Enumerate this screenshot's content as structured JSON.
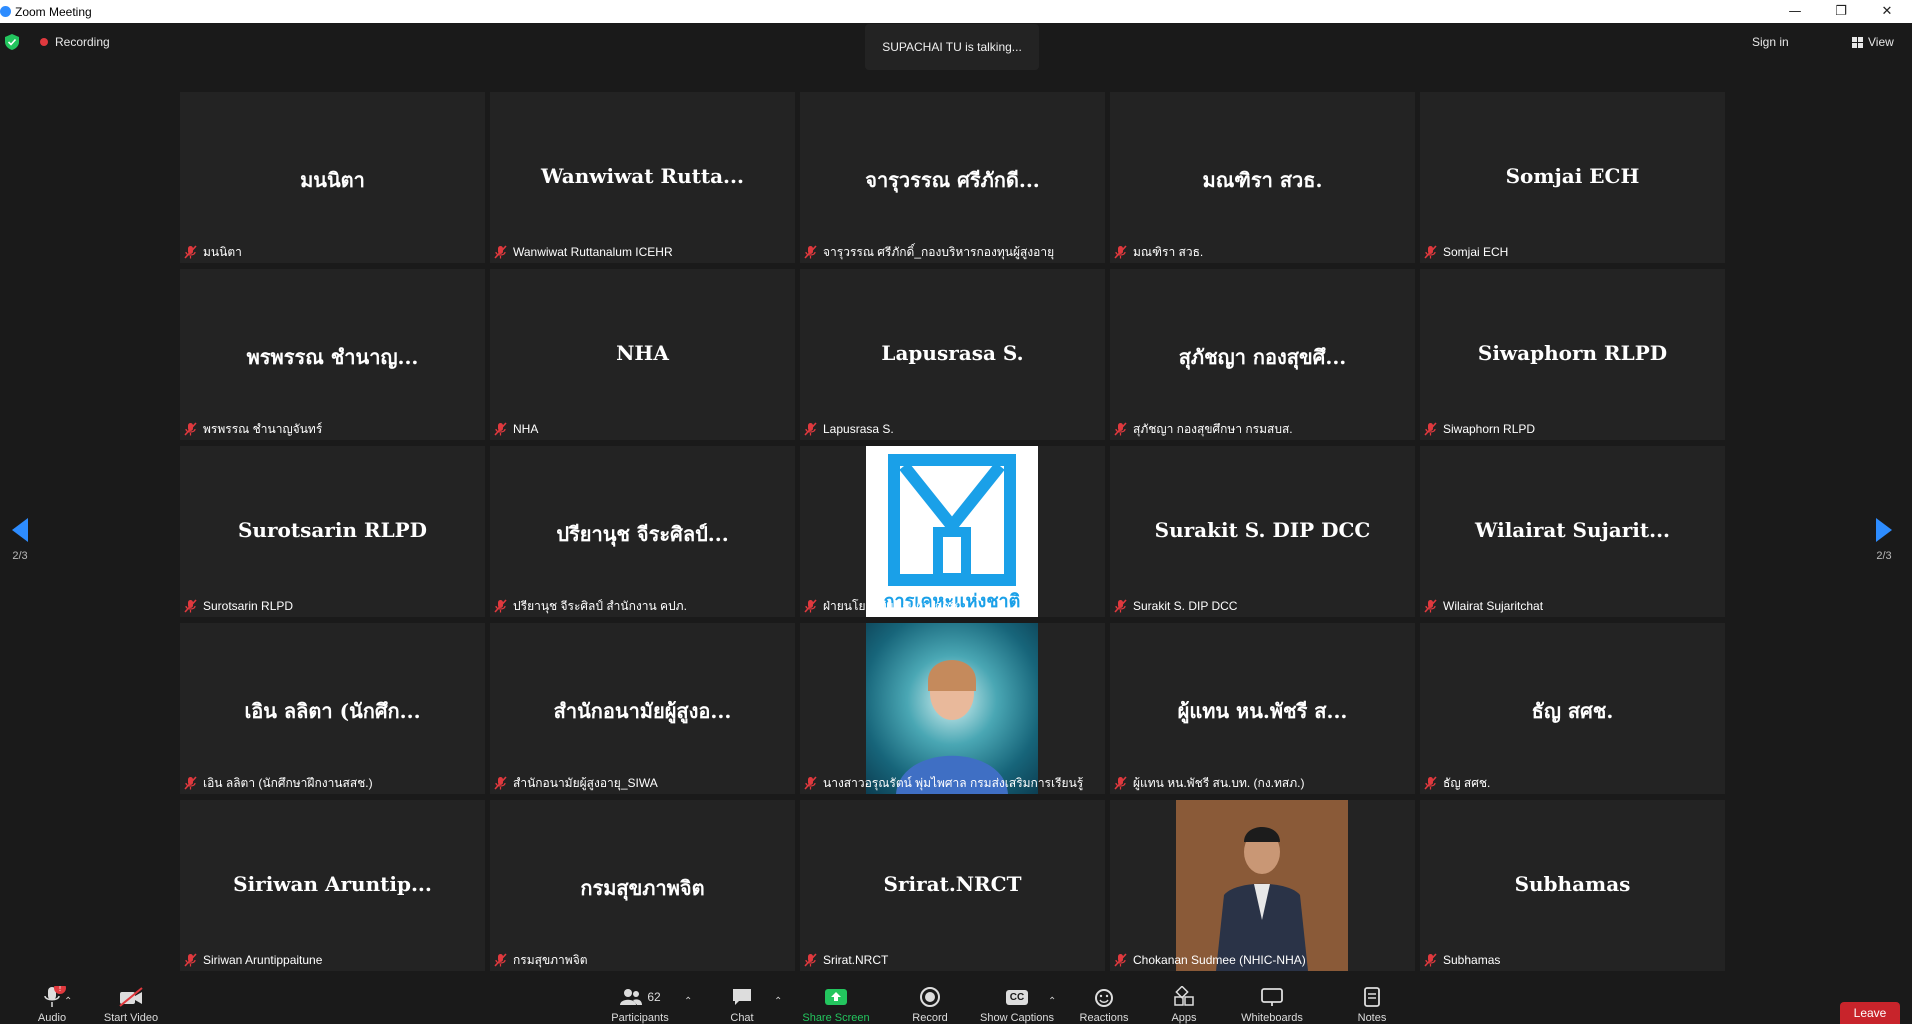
{
  "window": {
    "title": "Zoom Meeting",
    "min": "—",
    "max": "❐",
    "close": "✕"
  },
  "topbar": {
    "recording": "Recording",
    "talking": "SUPACHAI TU is talking...",
    "signin": "Sign in",
    "view": "View"
  },
  "pager": {
    "left": "2/3",
    "right": "2/3"
  },
  "tiles": [
    {
      "big": "มนนิตา",
      "label": "มนนิตา"
    },
    {
      "big": "Wanwiwat  Rutta...",
      "label": "Wanwiwat Ruttanalum ICEHR"
    },
    {
      "big": "จารุวรรณ ศรีภักดี...",
      "label": "จารุวรรณ ศรีภักดิ์_กองบริหารกองทุนผู้สูงอายุ"
    },
    {
      "big": "มณฑิรา สวธ.",
      "label": "มณฑิรา สวธ."
    },
    {
      "big": "Somjai ECH",
      "label": "Somjai ECH"
    },
    {
      "big": "พรพรรณ ชำนาญ...",
      "label": "พรพรรณ ชำนาญจันทร์"
    },
    {
      "big": "NHA",
      "label": "NHA"
    },
    {
      "big": "Lapusrasa S.",
      "label": "Lapusrasa S."
    },
    {
      "big": "สุภัชญา  กองสุขศึ...",
      "label": "สุภัชญา  กองสุขศึกษา กรมสบส."
    },
    {
      "big": "Siwaphorn RLPD",
      "label": "Siwaphorn RLPD"
    },
    {
      "big": "Surotsarin RLPD",
      "label": "Surotsarin RLPD"
    },
    {
      "big": "ปรียานุช จีระศิลป์...",
      "label": "ปรียานุช จีระศิลป์ สำนักงาน คปภ."
    },
    {
      "big": "",
      "label": "ฝ่ายนโยบายและแผน กคช.",
      "photo": "logo",
      "logo_text": "การเคหะแห่งชาติ"
    },
    {
      "big": "Surakit S. DIP DCC",
      "label": "Surakit S. DIP DCC"
    },
    {
      "big": "Wilairat   Sujarit...",
      "label": "Wilairat   Sujaritchat"
    },
    {
      "big": "เอิน ลลิตา (นักศึก...",
      "label": "เอิน ลลิตา (นักศึกษาฝึกงานสสช.)"
    },
    {
      "big": "สำนักอนามัยผู้สูงอ...",
      "label": "สำนักอนามัยผู้สูงอายุ_SIWA"
    },
    {
      "big": "",
      "label": "นางสาวอรุณรัตน์ พุ่มไพศาล กรมส่งเสริมการเรียนรู้",
      "photo": "avatar"
    },
    {
      "big": "ผู้แทน หน.พัชรี ส...",
      "label": "ผู้แทน หน.พัชรี สน.บท. (กง.ทสภ.)"
    },
    {
      "big": "ธัญ สศช.",
      "label": "ธัญ สศช."
    },
    {
      "big": "Siriwan  Aruntip...",
      "label": "Siriwan Aruntippaitune"
    },
    {
      "big": "กรมสุขภาพจิต",
      "label": "กรมสุขภาพจิต"
    },
    {
      "big": "Srirat.NRCT",
      "label": "Srirat.NRCT"
    },
    {
      "big": "",
      "label": "Chokanan Sudmee (NHIC-NHA)",
      "photo": "man"
    },
    {
      "big": "Subhamas",
      "label": "Subhamas"
    }
  ],
  "toolbar": {
    "audio": "Audio",
    "audio_badge": "!",
    "video": "Start Video",
    "participants": "Participants",
    "participants_count": "62",
    "chat": "Chat",
    "share": "Share Screen",
    "record": "Record",
    "captions": "Show Captions",
    "captions_icon": "CC",
    "reactions": "Reactions",
    "apps": "Apps",
    "whiteboards": "Whiteboards",
    "notes": "Notes",
    "leave": "Leave"
  },
  "colors": {
    "accent": "#2d8cff",
    "leave": "#c8242b",
    "mute": "#e0393e",
    "share": "#23c55e"
  }
}
